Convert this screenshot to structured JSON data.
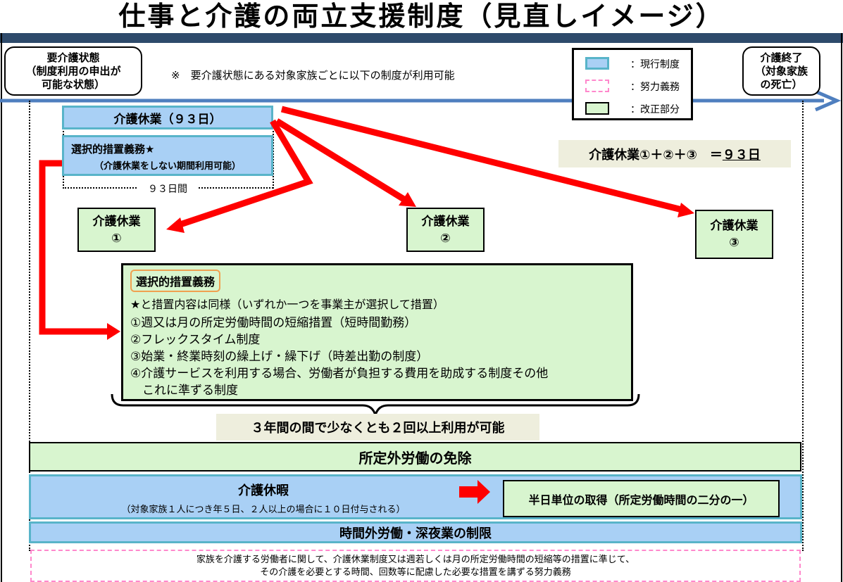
{
  "title": "仕事と介護の両立支援制度（見直しイメージ）",
  "left_state": {
    "line1": "要介護状態",
    "line2": "（制度利用の申出が",
    "line3": "可能な状態）"
  },
  "right_state": {
    "line1": "介護終了",
    "line2": "（対象家族",
    "line3": "の死亡）"
  },
  "note": "※　要介護状態にある対象家族ごとに以下の制度が利用可能",
  "legend": {
    "current": "：現行制度",
    "effort": "：努力義務",
    "revised": "：改正部分",
    "colors": {
      "current": "#a9d0f5",
      "effort": "#ff88cc",
      "revised": "#d8f5cf"
    }
  },
  "leave_93": "介護休業（９３日）",
  "selective_top": {
    "line1": "選択的措置義務★",
    "line2": "（介護休業をしない期間利用可能）"
  },
  "days_93": "９３日間",
  "formula": {
    "text": "介護休業①＋②＋③　＝",
    "value": "９３日"
  },
  "leave_parts": [
    {
      "line1": "介護休業",
      "line2": "①"
    },
    {
      "line1": "介護休業",
      "line2": "②"
    },
    {
      "line1": "介護休業",
      "line2": "③"
    }
  ],
  "selective_box": {
    "title": "選択的措置義務",
    "intro": "★と措置内容は同様（いずれか一つを事業主が選択して措置）",
    "items": [
      "①週又は月の所定労働時間の短縮措置（短時間勤務）",
      "②フレックスタイム制度",
      "③始業・終業時刻の繰上げ・繰下げ（時差出勤の制度）",
      "④介護サービスを利用する場合、労働者が負担する費用を助成する制度その他",
      "　これに準ずる制度"
    ]
  },
  "three_years": "３年間の間で少なくとも２回以上利用が可能",
  "overtime_exempt": "所定外労働の免除",
  "care_leave": {
    "title": "介護休暇",
    "sub": "（対象家族１人につき年５日、２人以上の場合に１０日付与される）"
  },
  "half_day": "半日単位の取得（所定労働時間の二分の一）",
  "overtime_limit": "時間外労働・深夜業の制限",
  "effort_note": {
    "line1": "家族を介護する労働者に関して、介護休業制度又は週若しくは月の所定労働時間の短縮等の措置に準じて、",
    "line2": "その介護を必要とする時間、回数等に配慮した必要な措置を講ずる努力義務"
  }
}
